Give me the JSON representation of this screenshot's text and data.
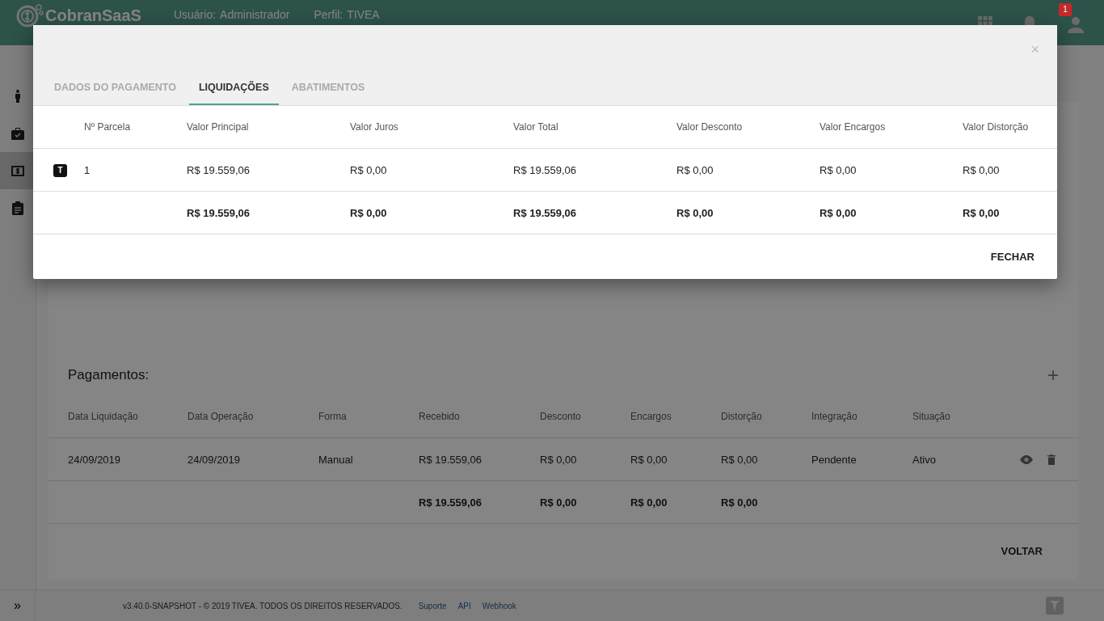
{
  "topbar": {
    "logo": "CobranSaaS",
    "user_label": "Usuário:",
    "user": "Administrador",
    "profile_label": "Perfil:",
    "profile": "TIVEA",
    "notification_count": "1"
  },
  "sidebar": {
    "items": [
      {
        "selected": false
      },
      {
        "selected": false
      },
      {
        "selected": true
      },
      {
        "selected": false
      }
    ],
    "toggle": "»"
  },
  "payments": {
    "title": "Pagamentos:",
    "add": "+",
    "columns": [
      "Data Liquidação",
      "Data Operação",
      "Forma",
      "Recebido",
      "Desconto",
      "Encargos",
      "Distorção",
      "Integração",
      "Situação"
    ],
    "rows": [
      [
        "24/09/2019",
        "24/09/2019",
        "Manual",
        "R$ 19.559,06",
        "R$ 0,00",
        "R$ 0,00",
        "R$ 0,00",
        "Pendente",
        "Ativo"
      ]
    ],
    "totals": [
      "R$ 19.559,06",
      "R$ 0,00",
      "R$ 0,00",
      "R$ 0,00"
    ],
    "back_button": "VOLTAR"
  },
  "footer": {
    "copyright": "v3.40.0-SNAPSHOT - © 2019 TIVEA. TODOS OS DIREITOS RESERVADOS.",
    "links": [
      "Suporte",
      "API",
      "Webhook"
    ]
  },
  "modal": {
    "close": "×",
    "tabs": [
      {
        "label": "DADOS DO PAGAMENTO",
        "selected": false
      },
      {
        "label": "LIQUIDAÇÕES",
        "selected": true
      },
      {
        "label": "ABATIMENTOS",
        "selected": false
      }
    ],
    "columns": [
      "Nº Parcela",
      "Valor Principal",
      "Valor Juros",
      "Valor Total",
      "Valor Desconto",
      "Valor Encargos",
      "Valor Distorção"
    ],
    "rows": [
      {
        "badge": "T",
        "cells": [
          "1",
          "R$ 19.559,06",
          "R$ 0,00",
          "R$ 19.559,06",
          "R$ 0,00",
          "R$ 0,00",
          "R$ 0,00"
        ]
      }
    ],
    "totals": [
      "R$ 19.559,06",
      "R$ 0,00",
      "R$ 19.559,06",
      "R$ 0,00",
      "R$ 0,00",
      "R$ 0,00"
    ],
    "close_button": "FECHAR"
  }
}
